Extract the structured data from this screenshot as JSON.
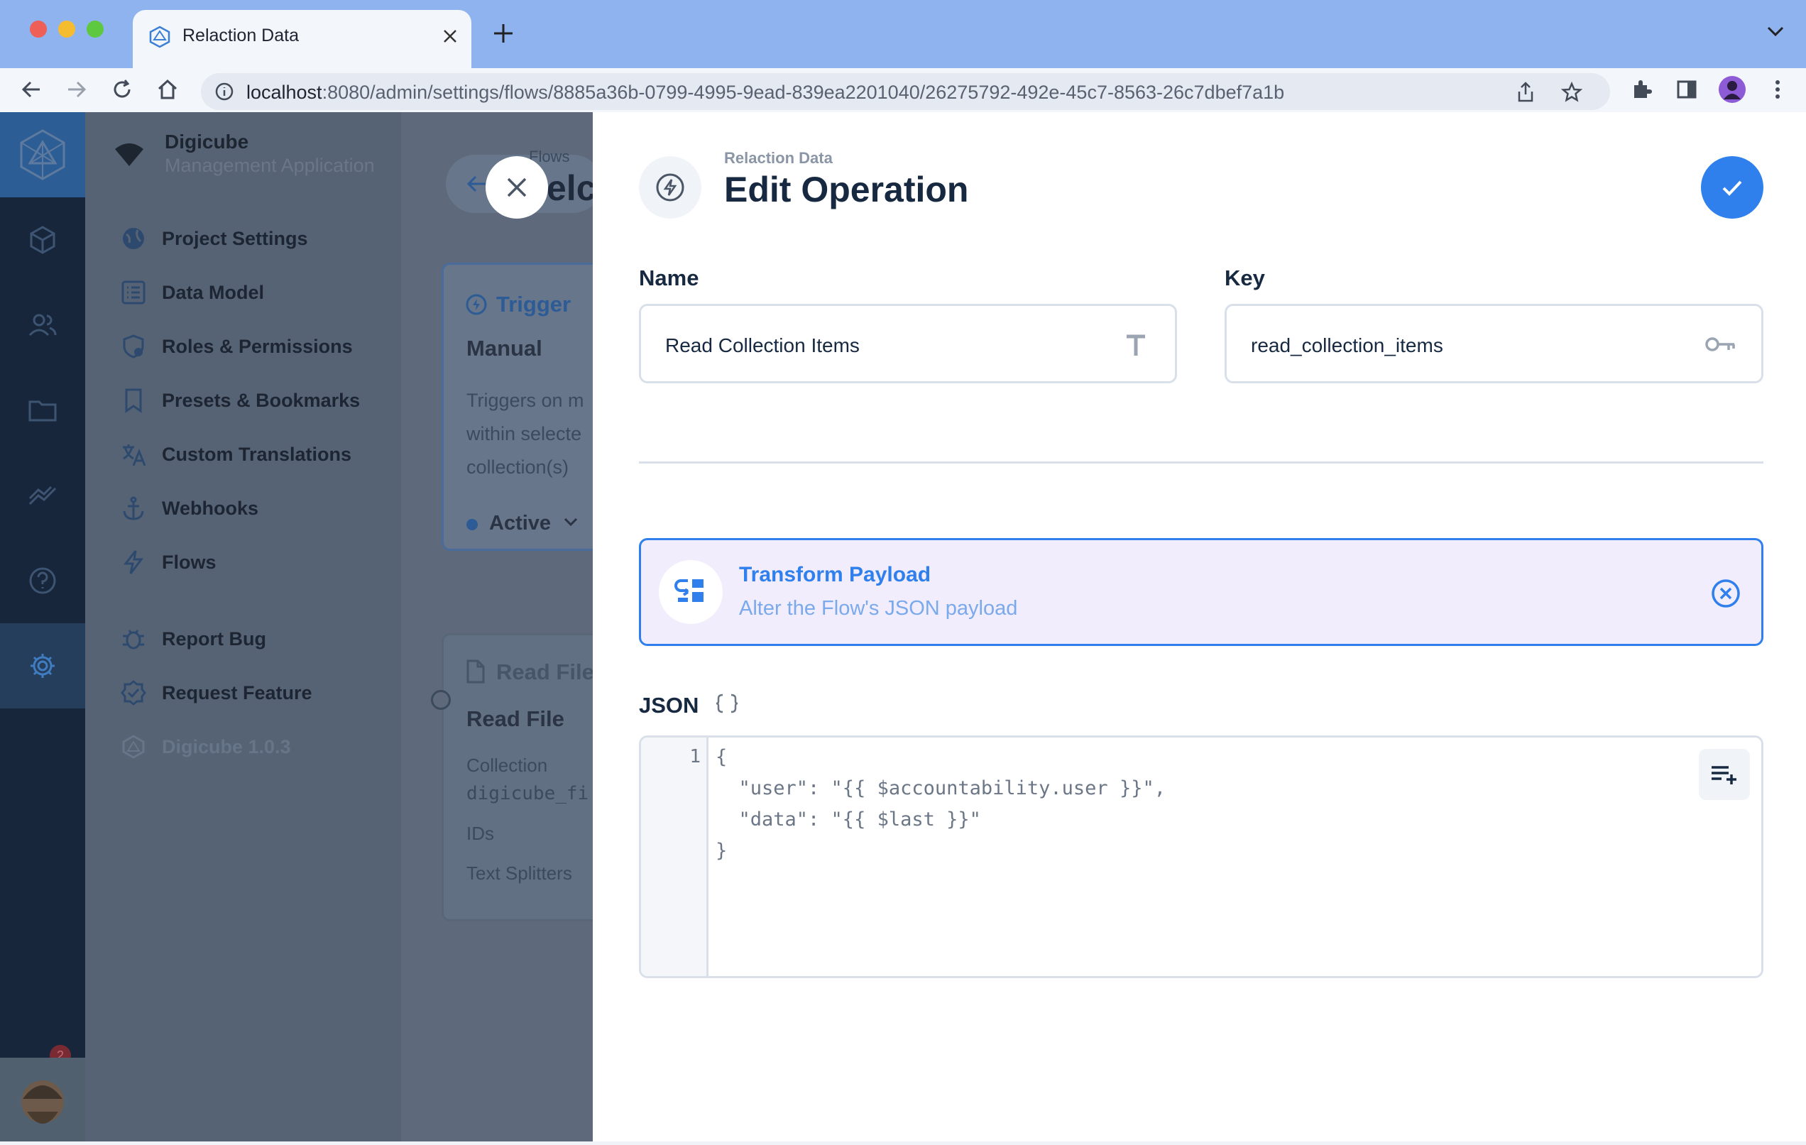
{
  "browser": {
    "tab_title": "Relaction Data",
    "url_host": "localhost",
    "url_path": ":8080/admin/settings/flows/8885a36b-0799-4995-9ead-839ea2201040/26275792-492e-45c7-8563-26c7dbef7a1b",
    "icons": [
      "back-icon",
      "forward-icon",
      "reload-icon",
      "home-icon",
      "info-icon",
      "share-icon",
      "star-icon",
      "extensions-icon",
      "sidepanel-icon",
      "profile-avatar",
      "menu-icon"
    ]
  },
  "rail": {
    "notifications_count": "2"
  },
  "nav": {
    "brand_title": "Digicube",
    "brand_subtitle": "Management Application",
    "items": [
      {
        "label": "Project Settings",
        "icon": "globe-icon"
      },
      {
        "label": "Data Model",
        "icon": "list-icon"
      },
      {
        "label": "Roles & Permissions",
        "icon": "shield-icon"
      },
      {
        "label": "Presets & Bookmarks",
        "icon": "bookmark-icon"
      },
      {
        "label": "Custom Translations",
        "icon": "translate-icon"
      },
      {
        "label": "Webhooks",
        "icon": "anchor-icon"
      },
      {
        "label": "Flows",
        "icon": "bolt-icon"
      },
      {
        "label": "Report Bug",
        "icon": "bug-icon"
      },
      {
        "label": "Request Feature",
        "icon": "check-badge-icon"
      }
    ],
    "version": "Digicube 1.0.3"
  },
  "background": {
    "breadcrumb_fragment": "Flows",
    "title_fragment": "elc",
    "trigger_card": {
      "header": "Trigger",
      "title": "Manual",
      "desc_lines": [
        "Triggers on m",
        "within selecte",
        "collection(s)"
      ],
      "status": "Active"
    },
    "read_card": {
      "header": "Read File",
      "title": "Read File",
      "collection_label": "Collection",
      "collection_value": "digicube_fi",
      "ids_label": "IDs",
      "splitters_label": "Text Splitters"
    }
  },
  "drawer": {
    "breadcrumb": "Relaction Data",
    "title": "Edit Operation",
    "name_label": "Name",
    "name_value": "Read Collection Items",
    "key_label": "Key",
    "key_value": "read_collection_items",
    "operation": {
      "title": "Transform Payload",
      "description": "Alter the Flow's JSON payload"
    },
    "json_label": "JSON",
    "code": {
      "line_number": "1",
      "lines": [
        "{",
        "  \"user\": \"{{ $accountability.user }}\",",
        "  \"data\": \"{{ $last }}\"",
        "}"
      ]
    }
  },
  "colors": {
    "accent": "#2f80ed",
    "chrome": "#8fb3ee",
    "rail": "#17263a",
    "operation_bg": "#f1edfc"
  }
}
